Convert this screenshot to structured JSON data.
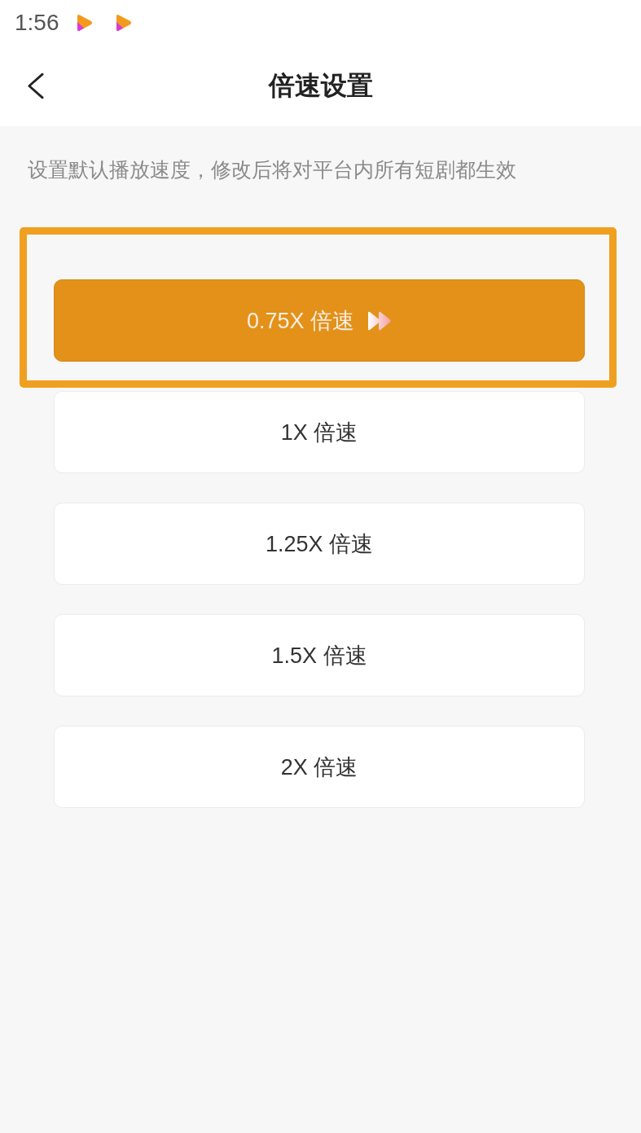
{
  "status_bar": {
    "time": "1:56"
  },
  "header": {
    "title": "倍速设置"
  },
  "description": "设置默认播放速度，修改后将对平台内所有短剧都生效",
  "speed_options": [
    {
      "label": "0.75X 倍速",
      "selected": true,
      "highlighted": true
    },
    {
      "label": "1X 倍速",
      "selected": false,
      "highlighted": false
    },
    {
      "label": "1.25X 倍速",
      "selected": false,
      "highlighted": false
    },
    {
      "label": "1.5X 倍速",
      "selected": false,
      "highlighted": false
    },
    {
      "label": "2X 倍速",
      "selected": false,
      "highlighted": false
    }
  ]
}
